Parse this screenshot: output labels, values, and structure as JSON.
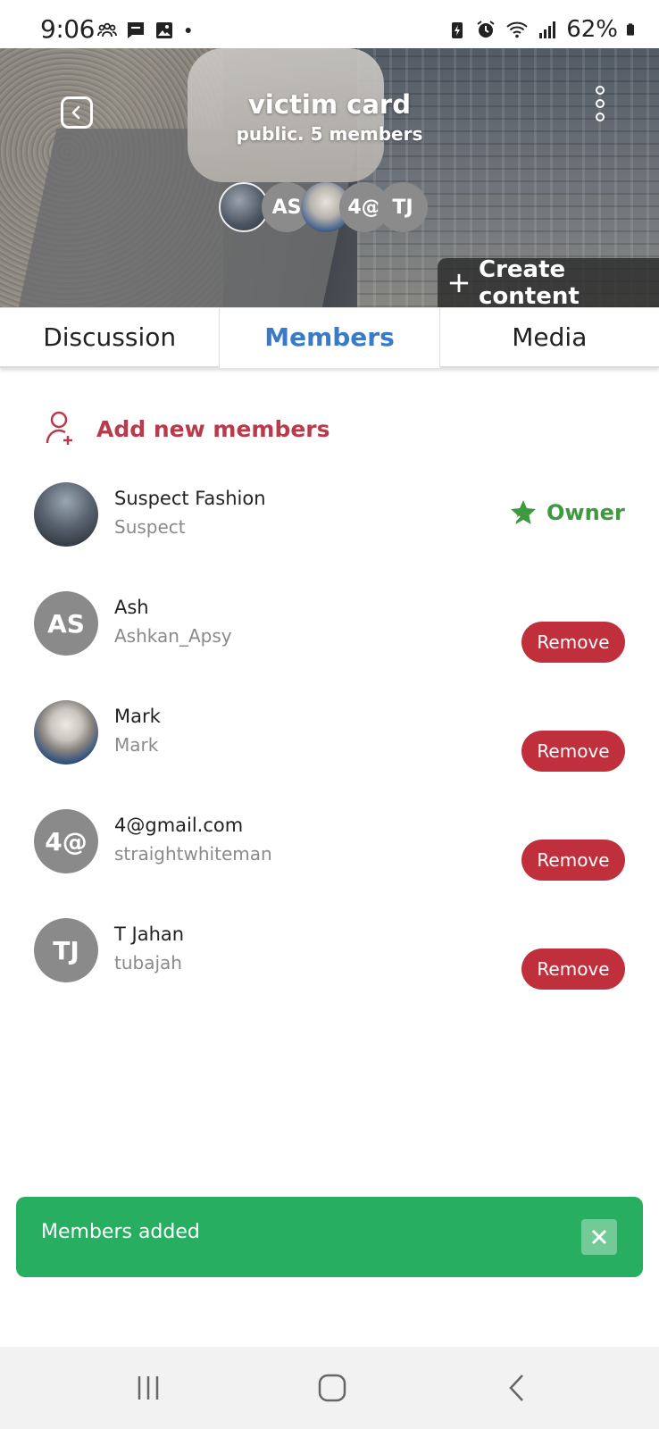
{
  "status_bar": {
    "time": "9:06",
    "battery": "62%"
  },
  "header": {
    "title": "victim card",
    "subtitle": "public. 5 members",
    "avatar_stack": [
      "AS",
      "4@",
      "TJ"
    ],
    "create_content_label": "Create content"
  },
  "tabs": [
    {
      "label": "Discussion",
      "active": false
    },
    {
      "label": "Members",
      "active": true
    },
    {
      "label": "Media",
      "active": false
    }
  ],
  "add_members_label": "Add new members",
  "members": [
    {
      "name": "Suspect Fashion",
      "handle": "Suspect",
      "initials": "",
      "role": "Owner"
    },
    {
      "name": "Ash",
      "handle": "Ashkan_Apsy",
      "initials": "AS",
      "action": "Remove"
    },
    {
      "name": "Mark",
      "handle": "Mark",
      "initials": "",
      "action": "Remove"
    },
    {
      "name": "4@gmail.com",
      "handle": "straightwhiteman",
      "initials": "4@",
      "action": "Remove"
    },
    {
      "name": "T Jahan",
      "handle": "tubajah",
      "initials": "TJ",
      "action": "Remove"
    }
  ],
  "toast": {
    "message": "Members added"
  },
  "colors": {
    "accent_blue": "#3a7bc8",
    "danger_red": "#c0303c",
    "owner_green": "#3f9a3f",
    "toast_green": "#27ae60"
  }
}
